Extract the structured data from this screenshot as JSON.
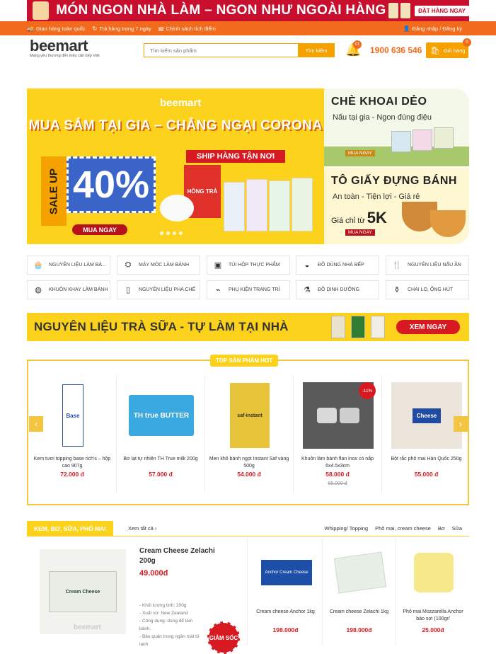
{
  "top_banner": {
    "text": "MÓN NGON NHÀ LÀM – NGON NHƯ NGOÀI HÀNG",
    "button": "ĐẶT HÀNG NGAY"
  },
  "topbar": {
    "items": [
      "Giao hàng toàn quốc",
      "Trả hàng trong 7 ngày",
      "Chính sách tích điểm"
    ],
    "login": "Đăng nhập / Đăng ký"
  },
  "header": {
    "logo_main": "bee",
    "logo_accent": "mart",
    "tagline": "Mang yêu thương đến triệu căn bếp Việt",
    "search_placeholder": "Tìm kiếm sản phẩm",
    "search_button": "Tìm kiếm",
    "notif_count": "01",
    "hotline": "1900 636 546",
    "cart_label": "Giỏ hàng",
    "cart_count": "0"
  },
  "hero": {
    "brand": "beemart",
    "title": "MUA SẮM TẠI GIA – CHẲNG NGẠI CORONA",
    "sale_up": "SALE UP",
    "percent": "40%",
    "ship": "SHIP HÀNG TẬN NƠI",
    "button": "MUA NGAY",
    "box_text": "HỒNG TRÀ"
  },
  "side_banners": [
    {
      "title": "CHÈ KHOAI DẺO",
      "subtitle": "Nấu tại gia - Ngon đúng điệu",
      "button": "MUA NGAY"
    },
    {
      "title": "TÔ GIẤY ĐỰNG BÁNH",
      "subtitle": "An toàn - Tiện lợi - Giá rẻ",
      "price_prefix": "Giá chỉ từ",
      "price": "5K",
      "button": "MUA NGAY"
    }
  ],
  "categories": [
    {
      "label": "NGUYÊN LIỆU LÀM BÁ...",
      "icon": "cupcake-icon"
    },
    {
      "label": "MÁY MÓC LÀM BÁNH",
      "icon": "mixer-icon"
    },
    {
      "label": "TÚI HỘP THỰC PHẨM",
      "icon": "box-icon"
    },
    {
      "label": "ĐỒ DÙNG NHÀ BẾP",
      "icon": "pot-icon"
    },
    {
      "label": "NGUYÊN LIỆU NẤU ĂN",
      "icon": "utensils-icon"
    },
    {
      "label": "KHUÔN KHAY LÀM BÁNH",
      "icon": "mold-icon"
    },
    {
      "label": "NGUYÊN LIỆU PHA CHẾ",
      "icon": "cup-icon"
    },
    {
      "label": "PHỤ KIỆN TRANG TRÍ",
      "icon": "piping-bag-icon"
    },
    {
      "label": "ĐỒ DINH DƯỠNG",
      "icon": "nutrition-icon"
    },
    {
      "label": "CHAI LỌ, ỐNG HÚT",
      "icon": "bottle-icon"
    }
  ],
  "promo": {
    "text": "NGUYÊN LIỆU TRÀ SỮA - TỰ LÀM TẠI NHÀ",
    "button": "XEM NGAY"
  },
  "hot": {
    "tag": "TOP SẢN PHẨM HOT",
    "products": [
      {
        "name": "Kem tươi topping base rich's – hộp cao 907g",
        "price": "72.000 đ",
        "old_price": "",
        "discount": "",
        "img_text": "Base",
        "img_color": "#ffffff"
      },
      {
        "name": "Bơ lạt tự nhiên TH True milk 200g",
        "price": "57.000 đ",
        "old_price": "",
        "discount": "",
        "img_text": "TH true BUTTER",
        "img_color": "#39a9df"
      },
      {
        "name": "Men khô bánh ngọt Instant Saf vàng 500g",
        "price": "54.000 đ",
        "old_price": "",
        "discount": "",
        "img_text": "saf-instant",
        "img_color": "#e7c43a"
      },
      {
        "name": "Khuôn làm bánh flan inox có nắp 6x4.5x3cm",
        "price": "58.000 đ",
        "old_price": "65.000 đ",
        "discount": "-11%",
        "img_text": "",
        "img_color": "#bcbcbc"
      },
      {
        "name": "Bột rắc phô mai Hàn Quốc 250g",
        "price": "55.000 đ",
        "old_price": "",
        "discount": "",
        "img_text": "Cheese",
        "img_color": "#e8a04a"
      }
    ]
  },
  "section": {
    "title": "KEM, BƠ, SỮA, PHÔ MAI",
    "view_all": "Xem tất cả ›",
    "tabs": [
      "Whipping/ Topping",
      "Phô mai, cream cheese",
      "Bơ",
      "Sữa"
    ],
    "featured": {
      "name": "Cream Cheese Zelachi 200g",
      "price": "49.000đ",
      "desc": [
        "- Khối lượng tịnh: 200g",
        "- Xuất xứ: New Zealand",
        "- Công dụng: dùng để làm bánh.",
        "- Bảo quản trong ngăn mát tủ lạnh"
      ],
      "badge": "GIẢM SỐC",
      "img_text": "Cream Cheese",
      "watermark": "beemart"
    },
    "products": [
      {
        "name": "Cream cheese Anchor 1kg",
        "price": "198.000đ",
        "img_text": "Anchor Cream Cheese",
        "img_color": "#1d4fa8"
      },
      {
        "name": "Cream cheese Zelachi 1kg",
        "price": "198.000đ",
        "img_text": "",
        "img_color": "#e7efe7"
      },
      {
        "name": "Phô mai Mozzarella Anchor bào sợi (100gr/",
        "price": "25.000đ",
        "img_text": "",
        "img_color": "#f7e98a"
      }
    ]
  }
}
